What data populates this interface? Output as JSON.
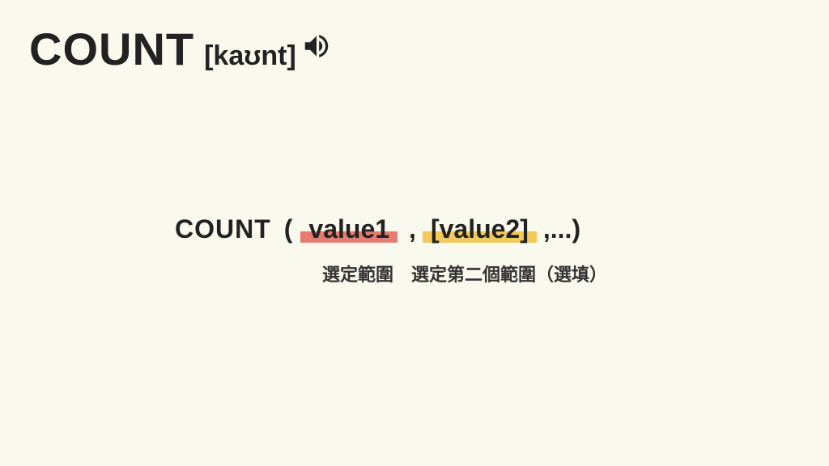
{
  "header": {
    "title": "COUNT",
    "phonetic": "[kaʊnt]"
  },
  "syntax": {
    "function_name": "COUNT",
    "open": "(",
    "arg1": "value1",
    "comma": ",",
    "arg2": "[value2]",
    "tail": ",...)",
    "label1": "選定範圍",
    "label2": "選定第二個範圍（選填）"
  },
  "colors": {
    "arg1_highlight": "#e77b6f",
    "arg2_highlight": "#f3c95a"
  }
}
